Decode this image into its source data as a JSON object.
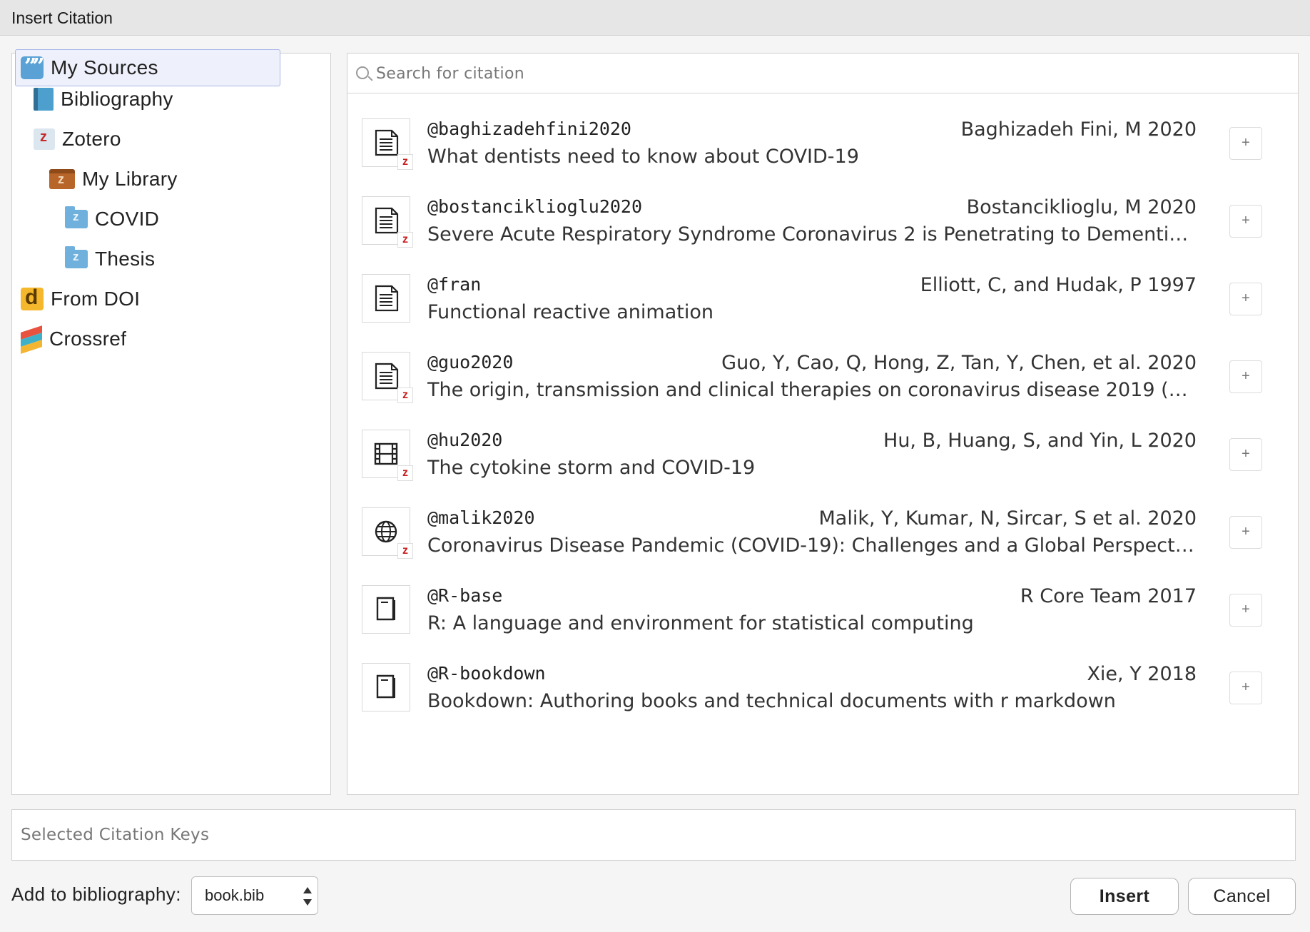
{
  "window": {
    "title": "Insert Citation"
  },
  "sources": [
    {
      "label": "My Sources",
      "icon": "quote-sources-icon"
    },
    {
      "label": "Bibliography",
      "icon": "book-icon"
    },
    {
      "label": "Zotero",
      "icon": "zotero-icon"
    },
    {
      "label": "My Library",
      "icon": "library-box-icon"
    },
    {
      "label": "COVID",
      "icon": "folder-icon"
    },
    {
      "label": "Thesis",
      "icon": "folder-icon"
    },
    {
      "label": "From DOI",
      "icon": "doi-icon"
    },
    {
      "label": "Crossref",
      "icon": "crossref-icon"
    }
  ],
  "search": {
    "placeholder": "Search for citation",
    "value": ""
  },
  "citations": [
    {
      "key": "@baghizadehfini2020",
      "authors": "Baghizadeh Fini, M 2020",
      "title": "What dentists need to know about COVID-19",
      "type": "document",
      "zotero": true,
      "add": "+"
    },
    {
      "key": "@bostanciklioglu2020",
      "authors": "Bostanciklioglu, M 2020",
      "title": "Severe Acute Respiratory Syndrome Coronavirus 2 is Penetrating to Dementia Re…",
      "type": "document",
      "zotero": true,
      "add": "+"
    },
    {
      "key": "@fran",
      "authors": "Elliott, C, and Hudak, P 1997",
      "title": "Functional reactive animation",
      "type": "document",
      "zotero": false,
      "add": "+"
    },
    {
      "key": "@guo2020",
      "authors": "Guo, Y, Cao, Q, Hong, Z, Tan, Y, Chen, et al. 2020",
      "title": "The origin, transmission and clinical therapies on coronavirus disease 2019 (CO…",
      "type": "document",
      "zotero": true,
      "add": "+"
    },
    {
      "key": "@hu2020",
      "authors": "Hu, B, Huang, S, and Yin, L 2020",
      "title": "The cytokine storm and COVID-19",
      "type": "film",
      "zotero": true,
      "add": "+"
    },
    {
      "key": "@malik2020",
      "authors": "Malik, Y, Kumar, N, Sircar, S et al. 2020",
      "title": "Coronavirus Disease Pandemic (COVID-19): Challenges and a Global Perspective",
      "type": "web",
      "zotero": true,
      "add": "+"
    },
    {
      "key": "@R-base",
      "authors": "R Core Team 2017",
      "title": "R: A language and environment for statistical computing",
      "type": "book",
      "zotero": false,
      "add": "+"
    },
    {
      "key": "@R-bookdown",
      "authors": "Xie, Y 2018",
      "title": "Bookdown: Authoring books and technical documents with r markdown",
      "type": "book",
      "zotero": false,
      "add": "+"
    }
  ],
  "zotero_badge": "z",
  "selected_keys": {
    "placeholder": "Selected Citation Keys",
    "value": ""
  },
  "footer": {
    "add_to_bib_label": "Add to bibliography:",
    "bib_file": "book.bib",
    "insert_label": "Insert",
    "cancel_label": "Cancel"
  }
}
